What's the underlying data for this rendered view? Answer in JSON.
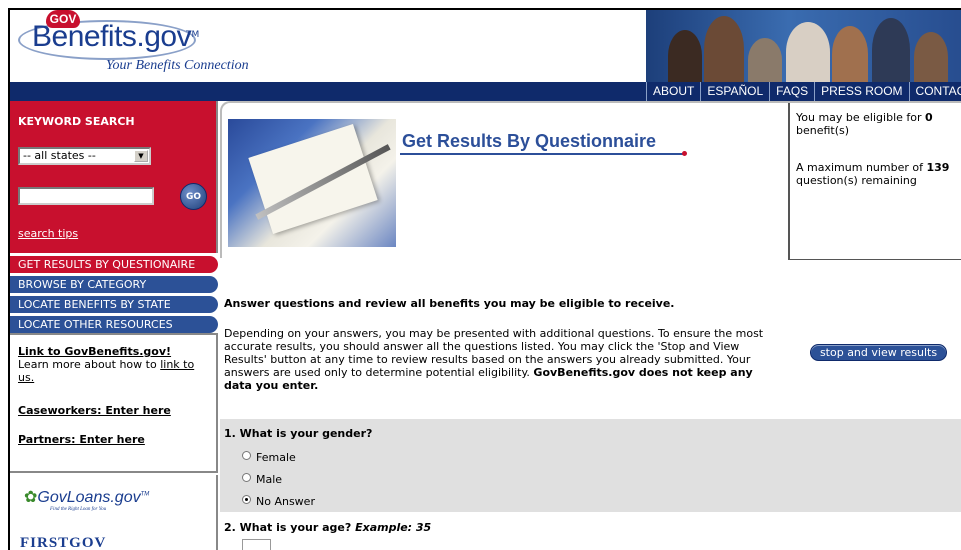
{
  "header": {
    "badge": "GOV",
    "logo_text": "Benefits.gov",
    "logo_tm": "TM",
    "tagline": "Your Benefits Connection"
  },
  "nav": {
    "items": [
      "ABOUT",
      "ESPAÑOL",
      "FAQS",
      "PRESS ROOM",
      "CONTACT US"
    ]
  },
  "sidebar": {
    "keyword_title": "KEYWORD SEARCH",
    "state_select": "-- all states --",
    "go_label": "GO",
    "search_tips": "search tips",
    "menu": [
      {
        "label": "GET RESULTS BY QUESTIONAIRE",
        "active": true
      },
      {
        "label": "BROWSE BY CATEGORY",
        "active": false
      },
      {
        "label": "LOCATE BENEFITS BY STATE",
        "active": false
      },
      {
        "label": "LOCATE OTHER RESOURCES",
        "active": false
      }
    ],
    "link_title": "Link to GovBenefits.gov!",
    "link_desc_pre": "Learn more about how to ",
    "link_desc_link": "link to us.",
    "caseworkers": "Caseworkers: Enter here",
    "partners": "Partners: Enter here",
    "govloans": "GovLoans.gov",
    "govloans_tm": "TM",
    "govloans_sub": "Find the Right Loan for You",
    "firstgov": "FIRSTGOV"
  },
  "main": {
    "title": "Get Results By Questionnaire",
    "eligible_pre": "You may be eligible for ",
    "eligible_count": "0",
    "eligible_post": " benefit(s)",
    "max_pre": "A maximum number of ",
    "max_count": "139",
    "max_post": " question(s) remaining",
    "intro_heading": "Answer questions and review all benefits you may be eligible to receive.",
    "intro_text": "Depending on your answers, you may be presented with additional questions. To ensure the most accurate results, you should answer all the questions listed. You may click the 'Stop and View Results' button at any time to review results based on the answers you already submitted. Your answers are used only to determine potential eligibility. ",
    "intro_bold": "GovBenefits.gov does not keep any data you enter.",
    "stop_button": "stop and view results"
  },
  "questions": [
    {
      "label": "1. What is your gender?",
      "options": [
        {
          "label": "Female",
          "selected": false
        },
        {
          "label": "Male",
          "selected": false
        },
        {
          "label": "No Answer",
          "selected": true
        }
      ]
    },
    {
      "label": "2. What is your age? ",
      "example": "Example: 35",
      "value": ""
    }
  ]
}
